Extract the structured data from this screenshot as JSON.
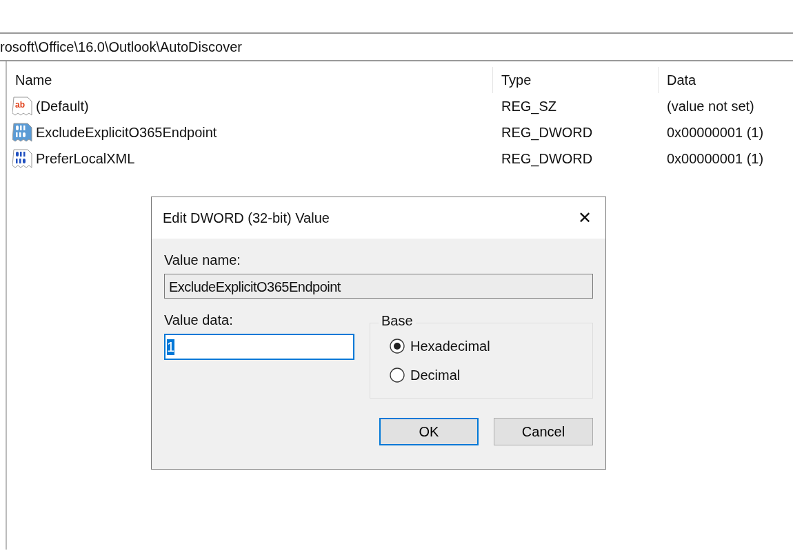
{
  "address_bar": {
    "path": "rosoft\\Office\\16.0\\Outlook\\AutoDiscover"
  },
  "table": {
    "columns": [
      "Name",
      "Type",
      "Data"
    ],
    "rows": [
      {
        "kind": "string",
        "icon_label": "ab",
        "name": "(Default)",
        "type": "REG_SZ",
        "data": "(value not set)",
        "selected": false
      },
      {
        "kind": "binary",
        "name": "ExcludeExplicitO365Endpoint",
        "type": "REG_DWORD",
        "data": "0x00000001 (1)",
        "selected": true
      },
      {
        "kind": "binary",
        "name": "PreferLocalXML",
        "type": "REG_DWORD",
        "data": "0x00000001 (1)",
        "selected": false
      }
    ]
  },
  "dialog": {
    "title": "Edit DWORD (32-bit) Value",
    "close": "✕",
    "value_name_label": "Value name:",
    "value_name": "ExcludeExplicitO365Endpoint",
    "value_data_label": "Value data:",
    "value_data": "1",
    "value_data_selected": true,
    "base_label": "Base",
    "base_options": [
      {
        "label": "Hexadecimal",
        "selected": true
      },
      {
        "label": "Decimal",
        "selected": false
      }
    ],
    "buttons": [
      {
        "label": "OK",
        "default": true
      },
      {
        "label": "Cancel",
        "default": false
      }
    ]
  }
}
